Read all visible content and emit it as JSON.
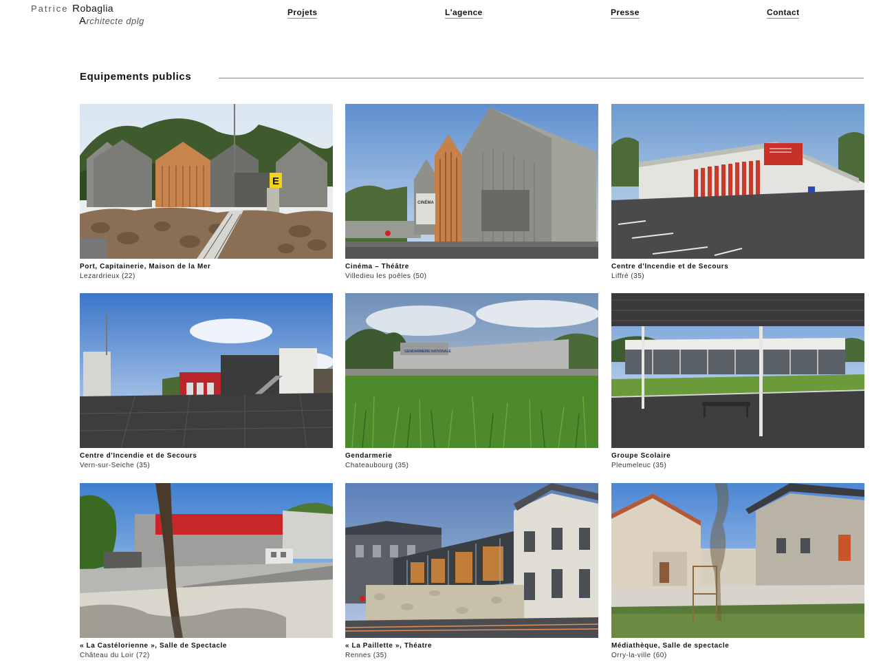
{
  "brand": {
    "first": "Patrice",
    "r_initial": "R",
    "last_rest": "obaglia",
    "a_initial": "A",
    "subtitle_rest": "rchitecte dplg"
  },
  "nav": {
    "projets": "Projets",
    "agence": "L'agence",
    "presse": "Presse",
    "contact": "Contact"
  },
  "section": {
    "title": "Equipements publics"
  },
  "projects": [
    {
      "title": "Port, Capitainerie, Maison de la Mer",
      "location": "Lezardrieux (22)"
    },
    {
      "title": "Cinéma – Théâtre",
      "location": "Villedieu les poêles (50)"
    },
    {
      "title": "Centre d'Incendie et de Secours",
      "location": "Liffré (35)"
    },
    {
      "title": "Centre d'Incendie et de Secours",
      "location": "Vern-sur-Seiche (35)"
    },
    {
      "title": "Gendarmerie",
      "location": "Chateaubourg (35)"
    },
    {
      "title": "Groupe Scolaire",
      "location": "Pleumeleuc (35)"
    },
    {
      "title": "« La Castélorienne », Salle de Spectacle",
      "location": "Château du Loir (72)"
    },
    {
      "title": "« La Paillette », Théatre",
      "location": "Rennes (35)"
    },
    {
      "title": "Médiathèque, Salle de spectacle",
      "location": "Orry-la-ville (60)"
    }
  ],
  "photo_signs": {
    "port_marker": "E",
    "cinema_sign": "CINÉMA",
    "gendarmerie_sign": "GENDARMERIE NATIONALE"
  }
}
